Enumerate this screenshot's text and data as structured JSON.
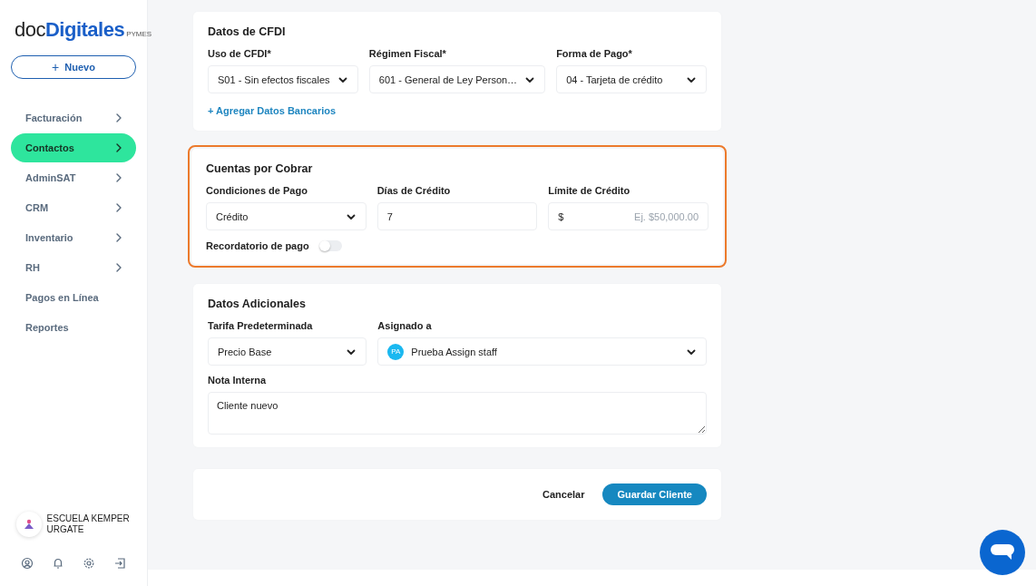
{
  "sidebar": {
    "logo": {
      "prefix": "doc",
      "brand": "Digitales",
      "suffix": "PYMES"
    },
    "new_button": {
      "icon": "+",
      "label": "Nuevo"
    },
    "items": [
      {
        "label": "Facturación",
        "kind": "group",
        "selected": false
      },
      {
        "label": "Contactos",
        "kind": "group",
        "selected": true
      },
      {
        "label": "AdminSAT",
        "kind": "group",
        "selected": false
      },
      {
        "label": "CRM",
        "kind": "group",
        "selected": false
      },
      {
        "label": "Inventario",
        "kind": "group",
        "selected": false
      },
      {
        "label": "RH",
        "kind": "group",
        "selected": false
      },
      {
        "label": "Pagos en Línea",
        "kind": "link",
        "selected": false
      },
      {
        "label": "Reportes",
        "kind": "link",
        "selected": false
      }
    ],
    "account": {
      "name": "ESCUELA KEMPER URGATE"
    }
  },
  "sections": [
    {
      "title": "Datos de CFDI",
      "highlighted": false,
      "fields": [
        {
          "kind": "select",
          "label": "Uso de CFDI*",
          "value": "S01 - Sin efectos fiscales"
        },
        {
          "kind": "select",
          "label": "Régimen Fiscal*",
          "value": "601 - General de Ley Person…"
        },
        {
          "kind": "select",
          "label": "Forma de Pago*",
          "value": "04 - Tarjeta de crédito"
        }
      ],
      "link": "+ Agregar Datos Bancarios"
    },
    {
      "title": "Cuentas por Cobrar",
      "highlighted": true,
      "fields": [
        {
          "kind": "select",
          "label": "Condiciones de Pago",
          "value": "Crédito"
        },
        {
          "kind": "input",
          "label": "Días de Crédito",
          "value": "7"
        },
        {
          "kind": "money",
          "label": "Límite de Crédito",
          "prefix": "$",
          "placeholder": "Ej. $50,000.00"
        }
      ],
      "toggle": {
        "label": "Recordatorio de pago",
        "on": false
      }
    },
    {
      "title": "Datos Adicionales",
      "highlighted": false,
      "fields": [
        {
          "kind": "select",
          "label": "Tarifa Predeterminada",
          "value": "Precio Base"
        },
        {
          "kind": "assignee",
          "label": "Asignado a",
          "initials": "PA",
          "value": "Prueba Assign staff"
        },
        {
          "kind": "textarea",
          "label": "Nota Interna",
          "value": "Cliente nuevo"
        }
      ]
    }
  ],
  "actions": {
    "cancel": "Cancelar",
    "save": "Guardar Cliente"
  }
}
